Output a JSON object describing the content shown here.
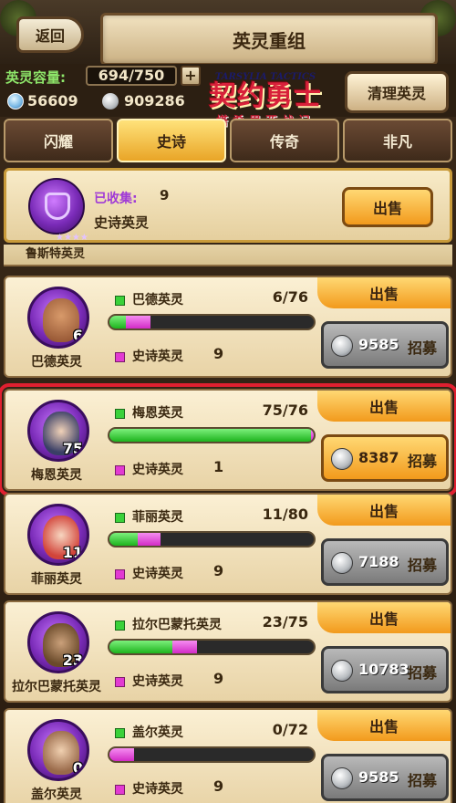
{
  "header": {
    "back_label": "返回",
    "title": "英灵重组"
  },
  "capacity": {
    "label": "英灵容量:",
    "value": "694/750",
    "plus": "+"
  },
  "currency": {
    "gems": "56609",
    "coins": "909286"
  },
  "clean_label": "清理英灵",
  "logo": {
    "small": "TARSYLIA TACTICS",
    "main": "契约勇士",
    "sub": "塔希里亚战记"
  },
  "tabs": [
    {
      "label": "闪耀",
      "active": false
    },
    {
      "label": "史诗",
      "active": true
    },
    {
      "label": "传奇",
      "active": false
    },
    {
      "label": "非凡",
      "active": false
    }
  ],
  "collection": {
    "collected_label": "已收集:",
    "collected_value": "9",
    "name": "史诗英灵",
    "sell_label": "出售"
  },
  "partial_row": {
    "name": "鲁斯特英灵"
  },
  "cards": [
    {
      "name": "巴德英灵",
      "count": "6",
      "spirit": "巴德英灵",
      "progress": "6/76",
      "green": 0.08,
      "pink": 0.12,
      "epic_label": "史诗英灵",
      "epic_count": "9",
      "sell": "出售",
      "cost": "9585",
      "recruit": "招募",
      "highlight": false,
      "active": false
    },
    {
      "name": "梅恩英灵",
      "count": "75",
      "spirit": "梅恩英灵",
      "progress": "75/76",
      "green": 0.987,
      "pink": 0.013,
      "epic_label": "史诗英灵",
      "epic_count": "1",
      "sell": "出售",
      "cost": "8387",
      "recruit": "招募",
      "highlight": true,
      "active": true
    },
    {
      "name": "菲丽英灵",
      "count": "11",
      "spirit": "菲丽英灵",
      "progress": "11/80",
      "green": 0.14,
      "pink": 0.11,
      "epic_label": "史诗英灵",
      "epic_count": "9",
      "sell": "出售",
      "cost": "7188",
      "recruit": "招募",
      "highlight": false,
      "active": false
    },
    {
      "name": "拉尔巴蒙托英灵",
      "count": "23",
      "spirit": "拉尔巴蒙托英灵",
      "progress": "23/75",
      "green": 0.31,
      "pink": 0.12,
      "epic_label": "史诗英灵",
      "epic_count": "9",
      "sell": "出售",
      "cost": "10783",
      "recruit": "招募",
      "highlight": false,
      "active": false
    },
    {
      "name": "盖尔英灵",
      "count": "0",
      "spirit": "盖尔英灵",
      "progress": "0/72",
      "green": 0.0,
      "pink": 0.12,
      "epic_label": "史诗英灵",
      "epic_count": "9",
      "sell": "出售",
      "cost": "9585",
      "recruit": "招募",
      "highlight": false,
      "active": false
    }
  ],
  "colors": {
    "accent": "#f29a1c",
    "highlight": "#e02030",
    "green": "#3ad13a",
    "pink": "#e23ad2"
  }
}
